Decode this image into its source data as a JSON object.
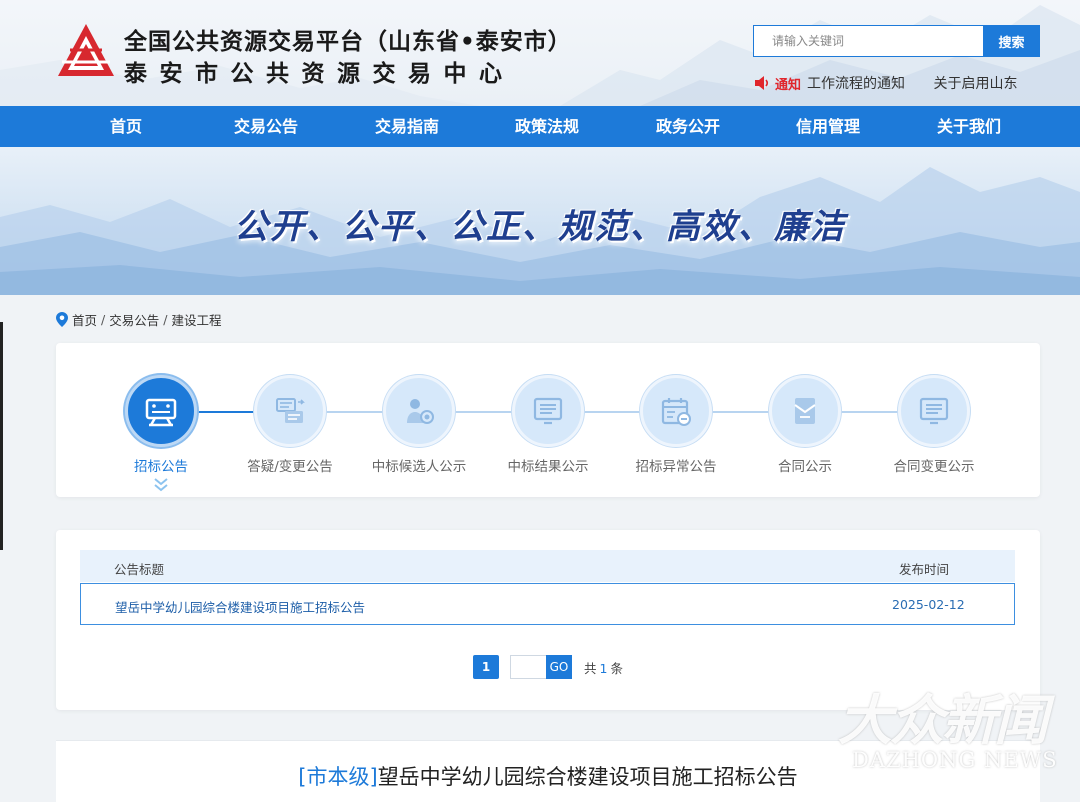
{
  "header": {
    "title_line1": "全国公共资源交易平台（山东省•泰安市）",
    "title_line2": "泰安市公共资源交易中心",
    "search_placeholder": "请输入关键词",
    "search_button": "搜索",
    "notice_tag": "通知",
    "notice_items": [
      "工作流程的通知",
      "关于启用山东"
    ]
  },
  "nav": {
    "items": [
      "首页",
      "交易公告",
      "交易指南",
      "政策法规",
      "政务公开",
      "信用管理",
      "关于我们"
    ]
  },
  "banner": {
    "slogan": "公开、公平、公正、规范、高效、廉洁"
  },
  "breadcrumb": {
    "items": [
      "首页",
      "交易公告",
      "建设工程"
    ],
    "separator": "/"
  },
  "steps": {
    "active_index": 0,
    "items": [
      {
        "label": "招标公告",
        "icon": "announcement-board-icon"
      },
      {
        "label": "答疑/变更公告",
        "icon": "swap-documents-icon"
      },
      {
        "label": "中标候选人公示",
        "icon": "candidate-person-icon"
      },
      {
        "label": "中标结果公示",
        "icon": "result-screen-icon"
      },
      {
        "label": "招标异常公告",
        "icon": "calendar-minus-icon"
      },
      {
        "label": "合同公示",
        "icon": "contract-envelope-icon"
      },
      {
        "label": "合同变更公示",
        "icon": "contract-change-screen-icon"
      }
    ]
  },
  "table": {
    "headers": [
      "公告标题",
      "发布时间"
    ],
    "rows": [
      {
        "title": "望岳中学幼儿园综合楼建设项目施工招标公告",
        "date": "2025-02-12"
      }
    ]
  },
  "pagination": {
    "current_page": "1",
    "go_label": "GO",
    "total_prefix": "共",
    "total_count": "1",
    "total_suffix": "条"
  },
  "detail": {
    "level": "[市本级]",
    "title": "望岳中学幼儿园综合楼建设项目施工招标公告"
  },
  "watermark": {
    "cn": "大众新闻",
    "en": "DAZHONG NEWS"
  },
  "colors": {
    "primary": "#1d7ad9",
    "notice_red": "#e0262c",
    "logo_red": "#d7282f"
  }
}
